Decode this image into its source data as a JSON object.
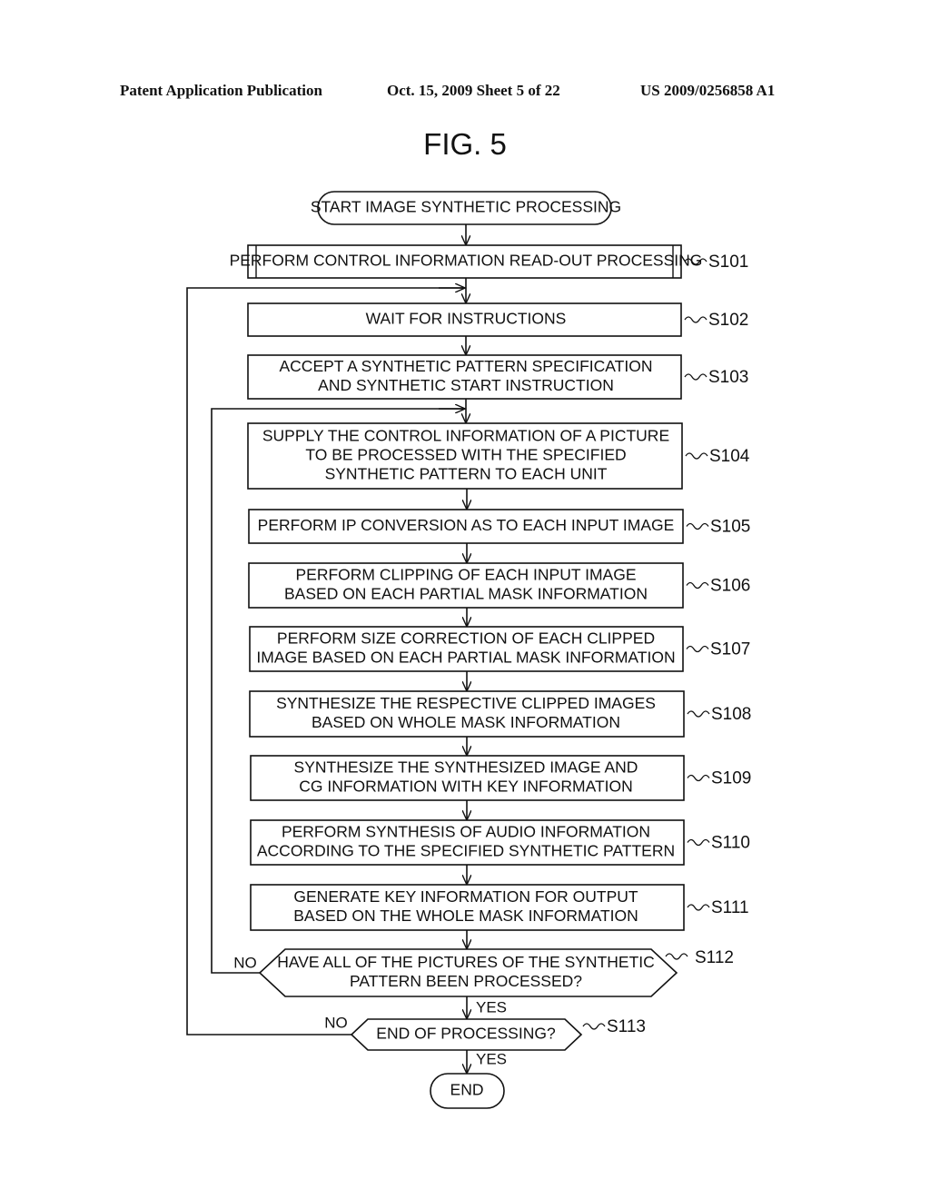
{
  "header": {
    "left": "Patent Application Publication",
    "center": "Oct. 15, 2009  Sheet 5 of 22",
    "right": "US 2009/0256858 A1"
  },
  "figure_title": "FIG. 5",
  "flowchart": {
    "start": "START IMAGE SYNTHETIC PROCESSING",
    "end": "END",
    "steps": [
      {
        "id": "S101",
        "lines": [
          "PERFORM CONTROL INFORMATION READ-OUT PROCESSING"
        ]
      },
      {
        "id": "S102",
        "lines": [
          "WAIT FOR INSTRUCTIONS"
        ]
      },
      {
        "id": "S103",
        "lines": [
          "ACCEPT A SYNTHETIC PATTERN SPECIFICATION",
          "AND SYNTHETIC START INSTRUCTION"
        ]
      },
      {
        "id": "S104",
        "lines": [
          "SUPPLY THE CONTROL INFORMATION OF A PICTURE",
          "TO BE PROCESSED WITH THE SPECIFIED",
          "SYNTHETIC PATTERN TO EACH UNIT"
        ]
      },
      {
        "id": "S105",
        "lines": [
          "PERFORM IP CONVERSION AS TO EACH INPUT IMAGE"
        ]
      },
      {
        "id": "S106",
        "lines": [
          "PERFORM CLIPPING OF EACH INPUT IMAGE",
          "BASED ON EACH PARTIAL MASK INFORMATION"
        ]
      },
      {
        "id": "S107",
        "lines": [
          "PERFORM SIZE CORRECTION OF EACH CLIPPED",
          "IMAGE BASED ON EACH PARTIAL MASK INFORMATION"
        ]
      },
      {
        "id": "S108",
        "lines": [
          "SYNTHESIZE THE RESPECTIVE CLIPPED IMAGES",
          "BASED ON WHOLE MASK INFORMATION"
        ]
      },
      {
        "id": "S109",
        "lines": [
          "SYNTHESIZE THE SYNTHESIZED IMAGE AND",
          "CG INFORMATION WITH KEY INFORMATION"
        ]
      },
      {
        "id": "S110",
        "lines": [
          "PERFORM SYNTHESIS OF AUDIO INFORMATION",
          "ACCORDING TO THE SPECIFIED SYNTHETIC PATTERN"
        ]
      },
      {
        "id": "S111",
        "lines": [
          "GENERATE KEY INFORMATION FOR OUTPUT",
          "BASED ON THE WHOLE MASK INFORMATION"
        ]
      }
    ],
    "decisions": [
      {
        "id": "S112",
        "lines": [
          "HAVE ALL OF THE PICTURES OF THE SYNTHETIC",
          "PATTERN BEEN PROCESSED?"
        ],
        "yes": "YES",
        "no": "NO"
      },
      {
        "id": "S113",
        "lines": [
          "END OF PROCESSING?"
        ],
        "yes": "YES",
        "no": "NO"
      }
    ]
  }
}
